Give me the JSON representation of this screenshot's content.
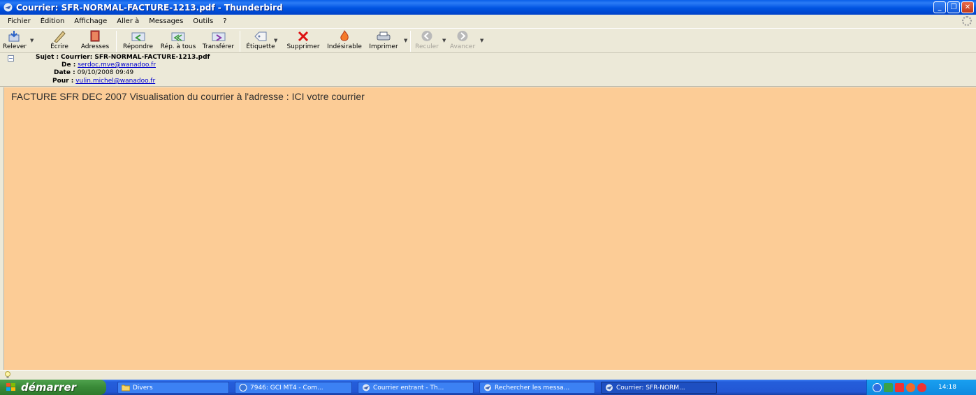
{
  "window": {
    "title": "Courrier: SFR-NORMAL-FACTURE-1213.pdf - Thunderbird",
    "controls": [
      "minimize",
      "maximize",
      "close"
    ]
  },
  "menu": [
    "Fichier",
    "Édition",
    "Affichage",
    "Aller à",
    "Messages",
    "Outils",
    "?"
  ],
  "toolbar": [
    {
      "label": "Relever",
      "icon": "get-mail-icon",
      "enabled": true
    },
    {
      "label": "Écrire",
      "icon": "write-pencil-icon",
      "enabled": true
    },
    {
      "label": "Adresses",
      "icon": "address-book-icon",
      "enabled": true
    },
    {
      "label": "Répondre",
      "icon": "reply-icon",
      "enabled": true
    },
    {
      "label": "Rép. à tous",
      "icon": "reply-all-icon",
      "enabled": true
    },
    {
      "label": "Transférer",
      "icon": "forward-icon",
      "enabled": true
    },
    {
      "label": "Étiquette",
      "icon": "tag-icon",
      "enabled": true
    },
    {
      "label": "Supprimer",
      "icon": "delete-x-icon",
      "enabled": true
    },
    {
      "label": "Indésirable",
      "icon": "junk-flame-icon",
      "enabled": true
    },
    {
      "label": "Imprimer",
      "icon": "printer-icon",
      "enabled": true
    },
    {
      "label": "Reculer",
      "icon": "back-arrow-icon",
      "enabled": false
    },
    {
      "label": "Avancer",
      "icon": "forward-arrow-icon",
      "enabled": false
    }
  ],
  "headers": {
    "subject_label": "Sujet :",
    "subject": "Courrier: SFR-NORMAL-FACTURE-1213.pdf",
    "from_label": "De :",
    "from": "serdoc.mve@wanadoo.fr",
    "date_label": "Date :",
    "date": "09/10/2008 09:49",
    "to_label": "Pour :",
    "to": "vulin.michel@wanadoo.fr"
  },
  "message_body": "FACTURE SFR DEC 2007 Visualisation du courrier à l'adresse : ICI votre courrier",
  "taskbar": {
    "start_label": "démarrer",
    "tasks": [
      {
        "label": "Divers",
        "icon": "folder-icon"
      },
      {
        "label": "7946: GCI MT4 - Com...",
        "icon": "browser-icon"
      },
      {
        "label": "Courrier entrant - Th...",
        "icon": "thunderbird-icon"
      },
      {
        "label": "Rechercher les messa...",
        "icon": "thunderbird-icon"
      },
      {
        "label": "Courrier: SFR-NORM...",
        "icon": "thunderbird-icon"
      }
    ],
    "clock": "14:18"
  },
  "colors": {
    "body_background": "#fccc96",
    "title_bar": "#0053e1",
    "taskbar": "#245edb",
    "start_button": "#3a8a38"
  }
}
